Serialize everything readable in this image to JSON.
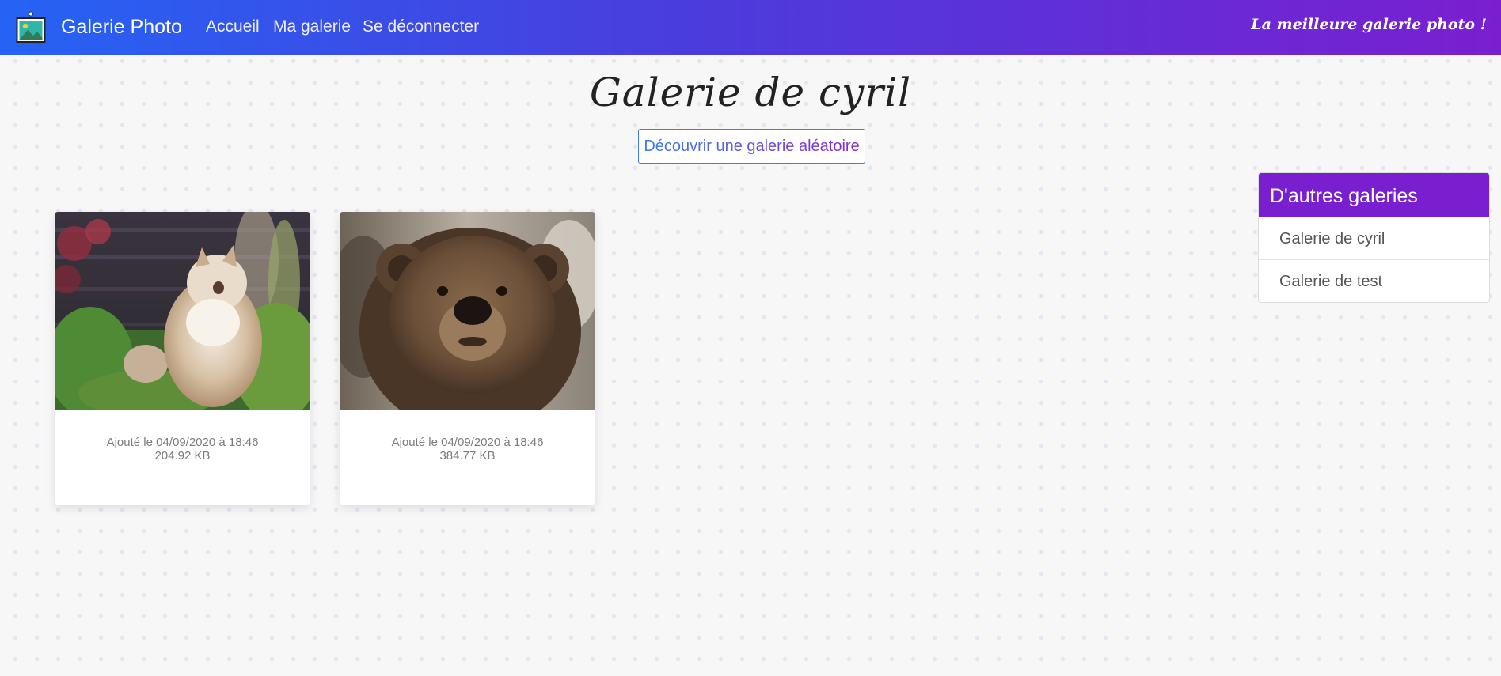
{
  "navbar": {
    "brand": "Galerie Photo",
    "links": [
      "Accueil",
      "Ma galerie",
      "Se déconnecter"
    ],
    "tagline": "La meilleure galerie photo !",
    "gradient_start": "#2563f4",
    "gradient_end": "#7a1fd0"
  },
  "page": {
    "title": "Galerie de cyril",
    "random_button": "Découvrir une galerie aléatoire"
  },
  "photos": [
    {
      "image": "cat-photo",
      "added": "Ajouté le 04/09/2020 à 18:46",
      "size": "204.92 KB"
    },
    {
      "image": "bear-photo",
      "added": "Ajouté le 04/09/2020 à 18:46",
      "size": "384.77 KB"
    }
  ],
  "sidebar": {
    "title": "D'autres galeries",
    "items": [
      "Galerie de cyril",
      "Galerie de test"
    ],
    "header_color": "#7a1fd0"
  }
}
